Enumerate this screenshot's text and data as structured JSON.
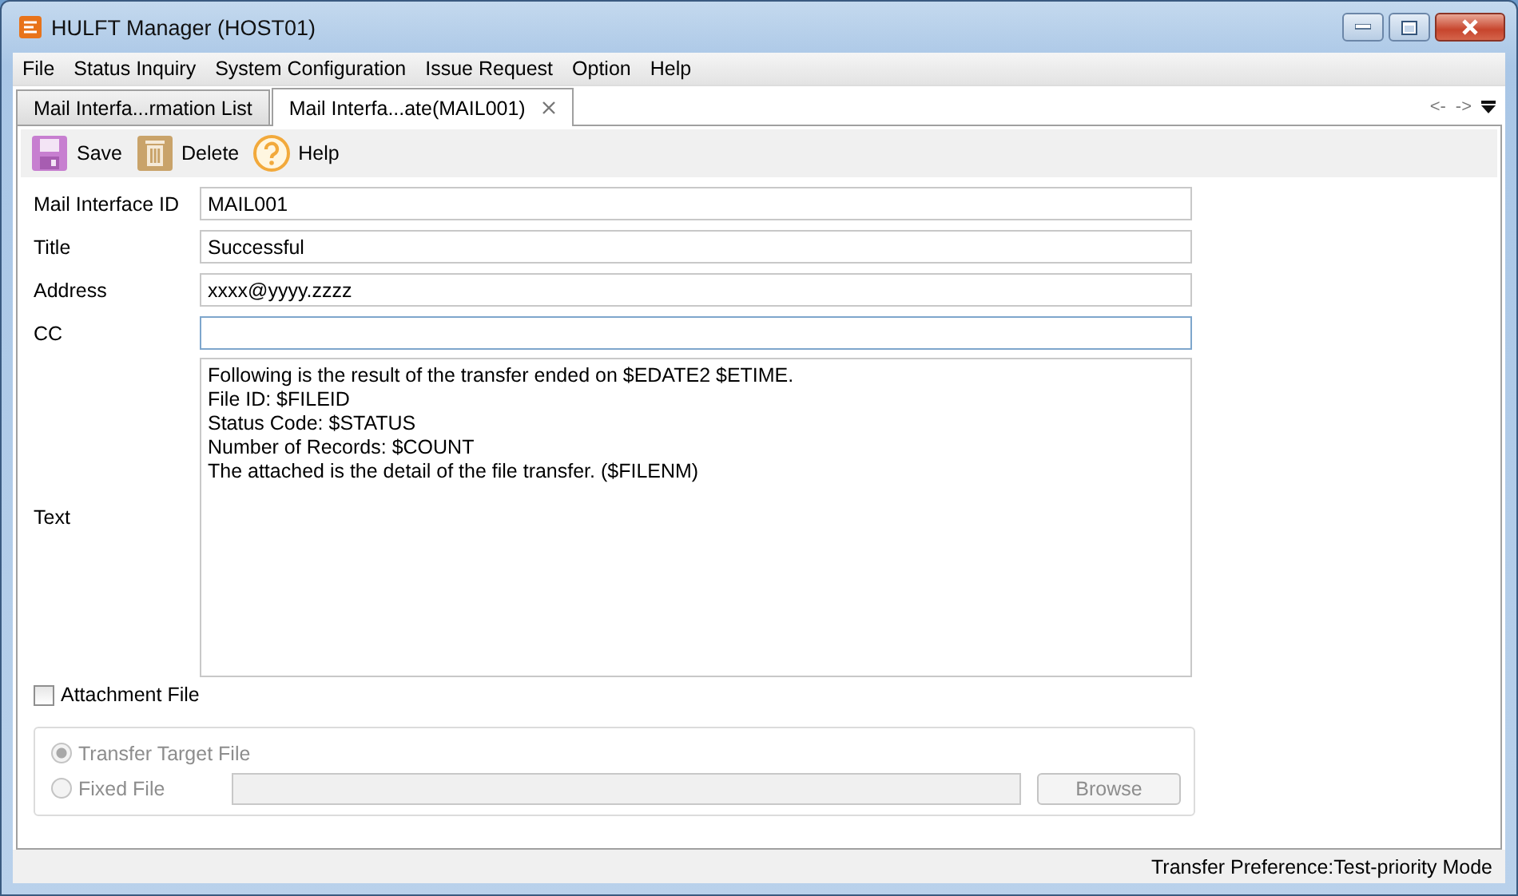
{
  "window": {
    "title": "HULFT Manager (HOST01)"
  },
  "menu": [
    {
      "label": "File"
    },
    {
      "label": "Status Inquiry"
    },
    {
      "label": "System Configuration"
    },
    {
      "label": "Issue Request"
    },
    {
      "label": "Option"
    },
    {
      "label": "Help"
    }
  ],
  "tabs": [
    {
      "label": "Mail Interfa...rmation List",
      "selected": false,
      "closable": false
    },
    {
      "label": "Mail Interfa...ate(MAIL001)",
      "selected": true,
      "closable": true
    }
  ],
  "tab_nav": {
    "back": "<-",
    "forward": "->"
  },
  "toolbar": [
    {
      "kind": "save",
      "label": "Save"
    },
    {
      "kind": "delete",
      "label": "Delete"
    },
    {
      "kind": "help",
      "label": "Help"
    }
  ],
  "fields": [
    {
      "label": "Mail Interface ID",
      "value": "MAIL001",
      "focused": false
    },
    {
      "label": "Title",
      "value": "Successful",
      "focused": false
    },
    {
      "label": "Address",
      "value": "xxxx@yyyy.zzzz",
      "focused": false
    },
    {
      "label": "CC",
      "focused": true
    }
  ],
  "text": {
    "label": "Text",
    "lines": [
      "Following is the result of the transfer ended on $EDATE2 $ETIME.",
      "File ID: $FILEID",
      "Status Code: $STATUS",
      "Number of Records: $COUNT",
      "The attached is the detail of the file transfer. ($FILENM)"
    ]
  },
  "attachment": {
    "label": "Attachment File",
    "checked": false
  },
  "attachment_options": [
    {
      "label": "Transfer Target File",
      "selected": true,
      "disabled": true
    },
    {
      "label": "Fixed File",
      "selected": false,
      "disabled": true
    }
  ],
  "fixed_file": {
    "disabled": true
  },
  "browse_button": {
    "label": "Browse",
    "disabled": true
  },
  "status_bar": {
    "text": "Transfer Preference:Test-priority Mode"
  }
}
